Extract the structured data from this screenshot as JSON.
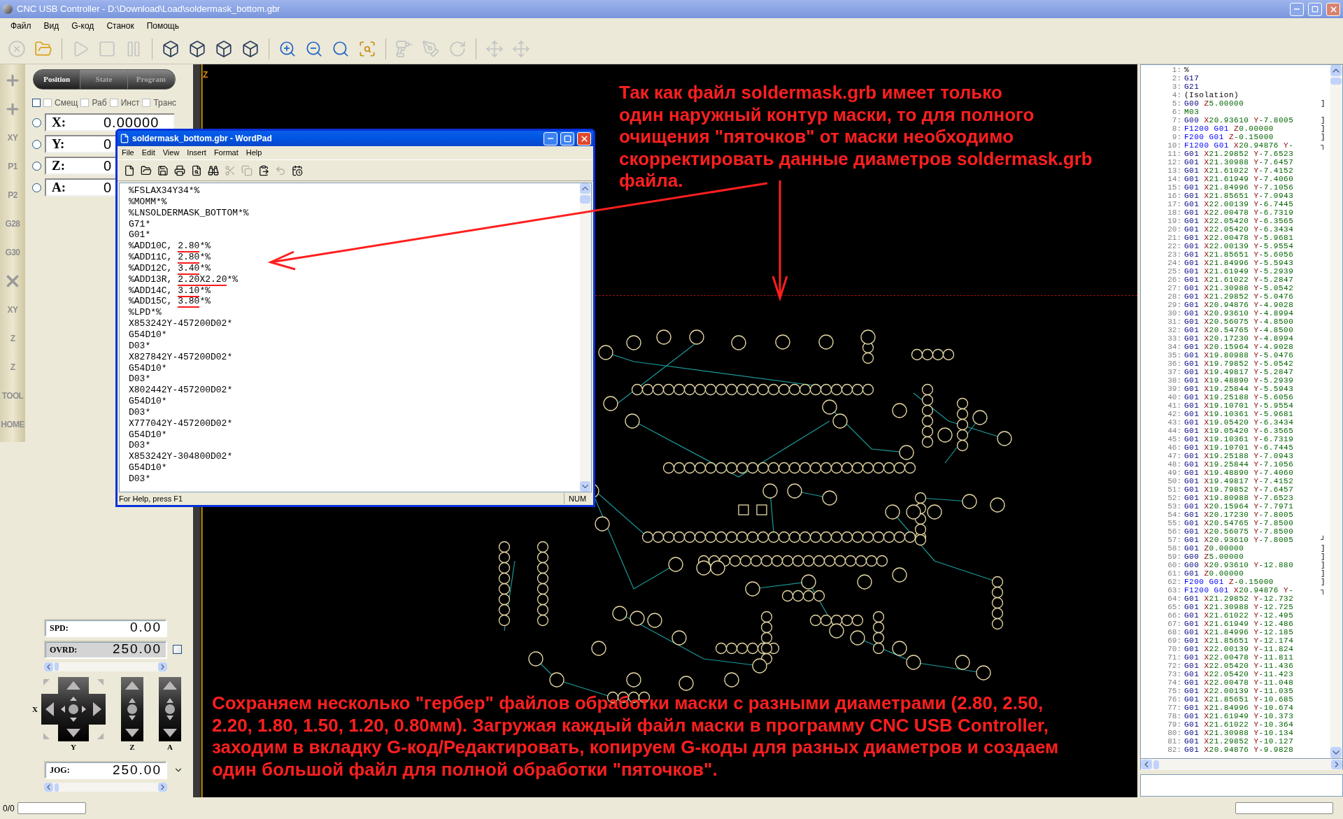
{
  "window": {
    "title": "CNC USB Controller - D:\\Download\\Load\\soldermask_bottom.gbr"
  },
  "menu": [
    "Файл",
    "Вид",
    "G-код",
    "Станок",
    "Помощь"
  ],
  "toolbar": [
    {
      "disabled": true
    },
    {
      "disabled": false
    },
    {
      "disabled": true
    },
    {
      "disabled": true
    },
    {
      "disabled": true
    },
    {
      "disabled": false
    },
    {
      "disabled": false
    },
    {
      "disabled": false
    },
    {
      "disabled": false
    },
    {
      "disabled": false
    },
    {
      "disabled": false
    },
    {
      "disabled": false
    },
    {
      "disabled": false
    },
    {
      "disabled": true
    },
    {
      "disabled": true
    },
    {
      "disabled": true
    },
    {
      "disabled": true
    },
    {
      "disabled": true
    }
  ],
  "jog_strip": [
    {
      "kind": "plus"
    },
    {
      "kind": "plus"
    },
    {
      "kind": "label",
      "label": "XY"
    },
    {
      "kind": "label",
      "label": "P1"
    },
    {
      "kind": "label",
      "label": "P2"
    },
    {
      "kind": "label",
      "label": "G28"
    },
    {
      "kind": "label",
      "label": "G30"
    },
    {
      "kind": "cross"
    },
    {
      "kind": "label",
      "label": "XY"
    },
    {
      "kind": "label",
      "label": "Z"
    },
    {
      "kind": "label",
      "label": "Z"
    },
    {
      "kind": "label",
      "label": "TOOL"
    },
    {
      "kind": "label",
      "label": "HOME"
    }
  ],
  "tabs": [
    {
      "label": "Position",
      "selected": true
    },
    {
      "label": "State",
      "selected": false
    },
    {
      "label": "Program",
      "selected": false
    }
  ],
  "checkboxes": [
    {
      "checked": false
    },
    {
      "label": "Смещ",
      "checked": false
    },
    {
      "label": "Раб",
      "checked": false
    },
    {
      "label": "Инст",
      "checked": false
    },
    {
      "label": "Транс",
      "checked": false
    }
  ],
  "axes": [
    {
      "label": "X:",
      "value": "0.00000",
      "selected": false
    },
    {
      "label": "Y:",
      "value": "0",
      "selected": false
    },
    {
      "label": "Z:",
      "value": "0",
      "selected": false
    },
    {
      "label": "A:",
      "value": "0",
      "selected": false
    }
  ],
  "spd": {
    "label": "SPD:",
    "value": "0.00"
  },
  "ovrd": {
    "label": "OVRD:",
    "value": "250.00",
    "checked": false
  },
  "jog_labels": {
    "x": "X",
    "y": "Y",
    "z": "Z",
    "a": "A"
  },
  "jog": {
    "label": "JOG:",
    "value": "250.00"
  },
  "canvas": {
    "axis_label": "Z"
  },
  "annotations": [
    [
      "Так как файл soldermask.grb имеет только",
      "один наружный контур маски, то для полного",
      "очищения \"пяточков\" от маски необходимо",
      "скорректировать данные диаметров soldermask.grb",
      "файла."
    ],
    [
      "Сохраняем несколько \"гербер\" файлов обработки маски с разными диаметрами (2.80, 2.50,",
      "2.20, 1.80, 1.50, 1.20, 0.80мм). Загружая каждый файл маски в программу CNC USB Controller,",
      "заходим в вкладку G-код/Редактировать, копируем G-коды для разных диаметров и создаем",
      "один большой файл для полной обработки \"пяточков\"."
    ]
  ],
  "wordpad": {
    "title": "soldermask_bottom.gbr - WordPad",
    "menu": [
      "File",
      "Edit",
      "View",
      "Insert",
      "Format",
      "Help"
    ],
    "toolbar": [
      {
        "disabled": false
      },
      {
        "disabled": false
      },
      {
        "disabled": false
      },
      {
        "disabled": false
      },
      {
        "disabled": false
      },
      {
        "disabled": false
      },
      {
        "disabled": true
      },
      {
        "disabled": true
      },
      {
        "disabled": false
      },
      {
        "disabled": true
      },
      {
        "disabled": false
      }
    ],
    "lines": [
      {
        "text": "%FSLAX34Y34*%"
      },
      {
        "text": "%MOMM*%"
      },
      {
        "text": "%LNSOLDERMASK_BOTTOM*%"
      },
      {
        "text": "G71*"
      },
      {
        "text": "G01*"
      },
      {
        "text": "%ADD10C, ",
        "underlined": "2.80",
        "after": "*%"
      },
      {
        "text": "%ADD11C, ",
        "underlined": "2.80",
        "after": "*%"
      },
      {
        "text": "%ADD12C, ",
        "underlined": "3.40",
        "after": "*%"
      },
      {
        "text": "%ADD13R, ",
        "underlined": "2.20X2.20",
        "after": "*%"
      },
      {
        "text": "%ADD14C, ",
        "underlined": "3.10",
        "after": "*%"
      },
      {
        "text": "%ADD15C, ",
        "underlined": "3.80",
        "after": "*%"
      },
      {
        "text": "%LPD*%"
      },
      {
        "text": "X853242Y-457200D02*"
      },
      {
        "text": "G54D10*"
      },
      {
        "text": "D03*"
      },
      {
        "text": "X827842Y-457200D02*"
      },
      {
        "text": "G54D10*"
      },
      {
        "text": "D03*"
      },
      {
        "text": "X802442Y-457200D02*"
      },
      {
        "text": "G54D10*"
      },
      {
        "text": "D03*"
      },
      {
        "text": "X777042Y-457200D02*"
      },
      {
        "text": "G54D10*"
      },
      {
        "text": "D03*"
      },
      {
        "text": "X853242Y-304800D02*"
      },
      {
        "text": "G54D10*"
      },
      {
        "text": "D03*"
      }
    ],
    "status": "For Help, press F1",
    "num": "NUM"
  },
  "code": [
    {
      "num": "1:",
      "tokens": [
        {
          "kind": "plain",
          "text": "%"
        }
      ]
    },
    {
      "num": "2:",
      "tokens": [
        {
          "kind": "cmd",
          "text": "G17"
        }
      ]
    },
    {
      "num": "3:",
      "tokens": [
        {
          "kind": "cmd",
          "text": "G21"
        }
      ]
    },
    {
      "num": "4:",
      "tokens": [
        {
          "kind": "plain",
          "text": "(Isolation)"
        }
      ]
    },
    {
      "num": "5:",
      "tokens": [
        {
          "kind": "cmd",
          "text": "G00"
        },
        {
          "kind": "axis",
          "text": "Z"
        },
        {
          "kind": "value",
          "text": "5.00000"
        }
      ],
      "marker": "]"
    },
    {
      "num": "6:",
      "tokens": [
        {
          "kind": "value",
          "text": "M03"
        }
      ]
    },
    {
      "num": "7:",
      "tokens": [
        {
          "kind": "cmd",
          "text": "G00"
        },
        {
          "kind": "axis",
          "text": "X"
        },
        {
          "kind": "value",
          "text": "20.93610"
        },
        {
          "kind": "axis",
          "text": "Y"
        },
        {
          "kind": "value",
          "text": "-7.8005"
        }
      ],
      "marker": "]"
    },
    {
      "num": "8:",
      "tokens": [
        {
          "kind": "feed",
          "text": "F1200 G01"
        },
        {
          "kind": "axis",
          "text": "Z"
        },
        {
          "kind": "value",
          "text": "0.00000"
        }
      ],
      "marker": "]"
    },
    {
      "num": "9:",
      "tokens": [
        {
          "kind": "feed",
          "text": "F200 G01"
        },
        {
          "kind": "axis",
          "text": "Z"
        },
        {
          "kind": "value",
          "text": "-0.15000"
        }
      ],
      "marker": "]"
    },
    {
      "num": "10:",
      "tokens": [
        {
          "kind": "feed",
          "text": "F1200 G01"
        },
        {
          "kind": "axis",
          "text": "X"
        },
        {
          "kind": "value",
          "text": "20.94876"
        },
        {
          "kind": "axis",
          "text": "Y"
        },
        {
          "kind": "value",
          "text": "-"
        }
      ],
      "marker": "┐"
    },
    {
      "num": "11:",
      "tokens": [
        {
          "kind": "cmd",
          "text": "G01"
        },
        {
          "kind": "axis",
          "text": "X"
        },
        {
          "kind": "value",
          "text": "21.29852"
        },
        {
          "kind": "axis",
          "text": "Y"
        },
        {
          "kind": "value",
          "text": "-7.6523"
        }
      ]
    },
    {
      "num": "12:",
      "tokens": [
        {
          "kind": "cmd",
          "text": "G01"
        },
        {
          "kind": "axis",
          "text": "X"
        },
        {
          "kind": "value",
          "text": "21.30988"
        },
        {
          "kind": "axis",
          "text": "Y"
        },
        {
          "kind": "value",
          "text": "-7.6457"
        }
      ]
    },
    {
      "num": "13:",
      "tokens": [
        {
          "kind": "cmd",
          "text": "G01"
        },
        {
          "kind": "axis",
          "text": "X"
        },
        {
          "kind": "value",
          "text": "21.61022"
        },
        {
          "kind": "axis",
          "text": "Y"
        },
        {
          "kind": "value",
          "text": "-7.4152"
        }
      ]
    },
    {
      "num": "14:",
      "tokens": [
        {
          "kind": "cmd",
          "text": "G01"
        },
        {
          "kind": "axis",
          "text": "X"
        },
        {
          "kind": "value",
          "text": "21.61949"
        },
        {
          "kind": "axis",
          "text": "Y"
        },
        {
          "kind": "value",
          "text": "-7.4060"
        }
      ]
    },
    {
      "num": "15:",
      "tokens": [
        {
          "kind": "cmd",
          "text": "G01"
        },
        {
          "kind": "axis",
          "text": "X"
        },
        {
          "kind": "value",
          "text": "21.84996"
        },
        {
          "kind": "axis",
          "text": "Y"
        },
        {
          "kind": "value",
          "text": "-7.1056"
        }
      ]
    },
    {
      "num": "16:",
      "tokens": [
        {
          "kind": "cmd",
          "text": "G01"
        },
        {
          "kind": "axis",
          "text": "X"
        },
        {
          "kind": "value",
          "text": "21.85651"
        },
        {
          "kind": "axis",
          "text": "Y"
        },
        {
          "kind": "value",
          "text": "-7.0943"
        }
      ]
    },
    {
      "num": "17:",
      "tokens": [
        {
          "kind": "cmd",
          "text": "G01"
        },
        {
          "kind": "axis",
          "text": "X"
        },
        {
          "kind": "value",
          "text": "22.00139"
        },
        {
          "kind": "axis",
          "text": "Y"
        },
        {
          "kind": "value",
          "text": "-6.7445"
        }
      ]
    },
    {
      "num": "18:",
      "tokens": [
        {
          "kind": "cmd",
          "text": "G01"
        },
        {
          "kind": "axis",
          "text": "X"
        },
        {
          "kind": "value",
          "text": "22.00478"
        },
        {
          "kind": "axis",
          "text": "Y"
        },
        {
          "kind": "value",
          "text": "-6.7319"
        }
      ]
    },
    {
      "num": "19:",
      "tokens": [
        {
          "kind": "cmd",
          "text": "G01"
        },
        {
          "kind": "axis",
          "text": "X"
        },
        {
          "kind": "value",
          "text": "22.05420"
        },
        {
          "kind": "axis",
          "text": "Y"
        },
        {
          "kind": "value",
          "text": "-6.3565"
        }
      ]
    },
    {
      "num": "20:",
      "tokens": [
        {
          "kind": "cmd",
          "text": "G01"
        },
        {
          "kind": "axis",
          "text": "X"
        },
        {
          "kind": "value",
          "text": "22.05420"
        },
        {
          "kind": "axis",
          "text": "Y"
        },
        {
          "kind": "value",
          "text": "-6.3434"
        }
      ]
    },
    {
      "num": "21:",
      "tokens": [
        {
          "kind": "cmd",
          "text": "G01"
        },
        {
          "kind": "axis",
          "text": "X"
        },
        {
          "kind": "value",
          "text": "22.00478"
        },
        {
          "kind": "axis",
          "text": "Y"
        },
        {
          "kind": "value",
          "text": "-5.9681"
        }
      ]
    },
    {
      "num": "22:",
      "tokens": [
        {
          "kind": "cmd",
          "text": "G01"
        },
        {
          "kind": "axis",
          "text": "X"
        },
        {
          "kind": "value",
          "text": "22.00139"
        },
        {
          "kind": "axis",
          "text": "Y"
        },
        {
          "kind": "value",
          "text": "-5.9554"
        }
      ]
    },
    {
      "num": "23:",
      "tokens": [
        {
          "kind": "cmd",
          "text": "G01"
        },
        {
          "kind": "axis",
          "text": "X"
        },
        {
          "kind": "value",
          "text": "21.85651"
        },
        {
          "kind": "axis",
          "text": "Y"
        },
        {
          "kind": "value",
          "text": "-5.6056"
        }
      ]
    },
    {
      "num": "24:",
      "tokens": [
        {
          "kind": "cmd",
          "text": "G01"
        },
        {
          "kind": "axis",
          "text": "X"
        },
        {
          "kind": "value",
          "text": "21.84996"
        },
        {
          "kind": "axis",
          "text": "Y"
        },
        {
          "kind": "value",
          "text": "-5.5943"
        }
      ]
    },
    {
      "num": "25:",
      "tokens": [
        {
          "kind": "cmd",
          "text": "G01"
        },
        {
          "kind": "axis",
          "text": "X"
        },
        {
          "kind": "value",
          "text": "21.61949"
        },
        {
          "kind": "axis",
          "text": "Y"
        },
        {
          "kind": "value",
          "text": "-5.2939"
        }
      ]
    },
    {
      "num": "26:",
      "tokens": [
        {
          "kind": "cmd",
          "text": "G01"
        },
        {
          "kind": "axis",
          "text": "X"
        },
        {
          "kind": "value",
          "text": "21.61022"
        },
        {
          "kind": "axis",
          "text": "Y"
        },
        {
          "kind": "value",
          "text": "-5.2847"
        }
      ]
    },
    {
      "num": "27:",
      "tokens": [
        {
          "kind": "cmd",
          "text": "G01"
        },
        {
          "kind": "axis",
          "text": "X"
        },
        {
          "kind": "value",
          "text": "21.30988"
        },
        {
          "kind": "axis",
          "text": "Y"
        },
        {
          "kind": "value",
          "text": "-5.0542"
        }
      ]
    },
    {
      "num": "28:",
      "tokens": [
        {
          "kind": "cmd",
          "text": "G01"
        },
        {
          "kind": "axis",
          "text": "X"
        },
        {
          "kind": "value",
          "text": "21.29852"
        },
        {
          "kind": "axis",
          "text": "Y"
        },
        {
          "kind": "value",
          "text": "-5.0476"
        }
      ]
    },
    {
      "num": "29:",
      "tokens": [
        {
          "kind": "cmd",
          "text": "G01"
        },
        {
          "kind": "axis",
          "text": "X"
        },
        {
          "kind": "value",
          "text": "20.94876"
        },
        {
          "kind": "axis",
          "text": "Y"
        },
        {
          "kind": "value",
          "text": "-4.9028"
        }
      ]
    },
    {
      "num": "30:",
      "tokens": [
        {
          "kind": "cmd",
          "text": "G01"
        },
        {
          "kind": "axis",
          "text": "X"
        },
        {
          "kind": "value",
          "text": "20.93610"
        },
        {
          "kind": "axis",
          "text": "Y"
        },
        {
          "kind": "value",
          "text": "-4.8994"
        }
      ]
    },
    {
      "num": "31:",
      "tokens": [
        {
          "kind": "cmd",
          "text": "G01"
        },
        {
          "kind": "axis",
          "text": "X"
        },
        {
          "kind": "value",
          "text": "20.56075"
        },
        {
          "kind": "axis",
          "text": "Y"
        },
        {
          "kind": "value",
          "text": "-4.8500"
        }
      ]
    },
    {
      "num": "32:",
      "tokens": [
        {
          "kind": "cmd",
          "text": "G01"
        },
        {
          "kind": "axis",
          "text": "X"
        },
        {
          "kind": "value",
          "text": "20.54765"
        },
        {
          "kind": "axis",
          "text": "Y"
        },
        {
          "kind": "value",
          "text": "-4.8500"
        }
      ]
    },
    {
      "num": "33:",
      "tokens": [
        {
          "kind": "cmd",
          "text": "G01"
        },
        {
          "kind": "axis",
          "text": "X"
        },
        {
          "kind": "value",
          "text": "20.17230"
        },
        {
          "kind": "axis",
          "text": "Y"
        },
        {
          "kind": "value",
          "text": "-4.8994"
        }
      ]
    },
    {
      "num": "34:",
      "tokens": [
        {
          "kind": "cmd",
          "text": "G01"
        },
        {
          "kind": "axis",
          "text": "X"
        },
        {
          "kind": "value",
          "text": "20.15964"
        },
        {
          "kind": "axis",
          "text": "Y"
        },
        {
          "kind": "value",
          "text": "-4.9028"
        }
      ]
    },
    {
      "num": "35:",
      "tokens": [
        {
          "kind": "cmd",
          "text": "G01"
        },
        {
          "kind": "axis",
          "text": "X"
        },
        {
          "kind": "value",
          "text": "19.80988"
        },
        {
          "kind": "axis",
          "text": "Y"
        },
        {
          "kind": "value",
          "text": "-5.0476"
        }
      ]
    },
    {
      "num": "36:",
      "tokens": [
        {
          "kind": "cmd",
          "text": "G01"
        },
        {
          "kind": "axis",
          "text": "X"
        },
        {
          "kind": "value",
          "text": "19.79852"
        },
        {
          "kind": "axis",
          "text": "Y"
        },
        {
          "kind": "value",
          "text": "-5.0542"
        }
      ]
    },
    {
      "num": "37:",
      "tokens": [
        {
          "kind": "cmd",
          "text": "G01"
        },
        {
          "kind": "axis",
          "text": "X"
        },
        {
          "kind": "value",
          "text": "19.49817"
        },
        {
          "kind": "axis",
          "text": "Y"
        },
        {
          "kind": "value",
          "text": "-5.2847"
        }
      ]
    },
    {
      "num": "38:",
      "tokens": [
        {
          "kind": "cmd",
          "text": "G01"
        },
        {
          "kind": "axis",
          "text": "X"
        },
        {
          "kind": "value",
          "text": "19.48890"
        },
        {
          "kind": "axis",
          "text": "Y"
        },
        {
          "kind": "value",
          "text": "-5.2939"
        }
      ]
    },
    {
      "num": "39:",
      "tokens": [
        {
          "kind": "cmd",
          "text": "G01"
        },
        {
          "kind": "axis",
          "text": "X"
        },
        {
          "kind": "value",
          "text": "19.25844"
        },
        {
          "kind": "axis",
          "text": "Y"
        },
        {
          "kind": "value",
          "text": "-5.5943"
        }
      ]
    },
    {
      "num": "40:",
      "tokens": [
        {
          "kind": "cmd",
          "text": "G01"
        },
        {
          "kind": "axis",
          "text": "X"
        },
        {
          "kind": "value",
          "text": "19.25188"
        },
        {
          "kind": "axis",
          "text": "Y"
        },
        {
          "kind": "value",
          "text": "-5.6056"
        }
      ]
    },
    {
      "num": "41:",
      "tokens": [
        {
          "kind": "cmd",
          "text": "G01"
        },
        {
          "kind": "axis",
          "text": "X"
        },
        {
          "kind": "value",
          "text": "19.10701"
        },
        {
          "kind": "axis",
          "text": "Y"
        },
        {
          "kind": "value",
          "text": "-5.9554"
        }
      ]
    },
    {
      "num": "42:",
      "tokens": [
        {
          "kind": "cmd",
          "text": "G01"
        },
        {
          "kind": "axis",
          "text": "X"
        },
        {
          "kind": "value",
          "text": "19.10361"
        },
        {
          "kind": "axis",
          "text": "Y"
        },
        {
          "kind": "value",
          "text": "-5.9681"
        }
      ]
    },
    {
      "num": "43:",
      "tokens": [
        {
          "kind": "cmd",
          "text": "G01"
        },
        {
          "kind": "axis",
          "text": "X"
        },
        {
          "kind": "value",
          "text": "19.05420"
        },
        {
          "kind": "axis",
          "text": "Y"
        },
        {
          "kind": "value",
          "text": "-6.3434"
        }
      ]
    },
    {
      "num": "44:",
      "tokens": [
        {
          "kind": "cmd",
          "text": "G01"
        },
        {
          "kind": "axis",
          "text": "X"
        },
        {
          "kind": "value",
          "text": "19.05420"
        },
        {
          "kind": "axis",
          "text": "Y"
        },
        {
          "kind": "value",
          "text": "-6.3565"
        }
      ]
    },
    {
      "num": "45:",
      "tokens": [
        {
          "kind": "cmd",
          "text": "G01"
        },
        {
          "kind": "axis",
          "text": "X"
        },
        {
          "kind": "value",
          "text": "19.10361"
        },
        {
          "kind": "axis",
          "text": "Y"
        },
        {
          "kind": "value",
          "text": "-6.7319"
        }
      ]
    },
    {
      "num": "46:",
      "tokens": [
        {
          "kind": "cmd",
          "text": "G01"
        },
        {
          "kind": "axis",
          "text": "X"
        },
        {
          "kind": "value",
          "text": "19.10701"
        },
        {
          "kind": "axis",
          "text": "Y"
        },
        {
          "kind": "value",
          "text": "-6.7445"
        }
      ]
    },
    {
      "num": "47:",
      "tokens": [
        {
          "kind": "cmd",
          "text": "G01"
        },
        {
          "kind": "axis",
          "text": "X"
        },
        {
          "kind": "value",
          "text": "19.25188"
        },
        {
          "kind": "axis",
          "text": "Y"
        },
        {
          "kind": "value",
          "text": "-7.0943"
        }
      ]
    },
    {
      "num": "48:",
      "tokens": [
        {
          "kind": "cmd",
          "text": "G01"
        },
        {
          "kind": "axis",
          "text": "X"
        },
        {
          "kind": "value",
          "text": "19.25844"
        },
        {
          "kind": "axis",
          "text": "Y"
        },
        {
          "kind": "value",
          "text": "-7.1056"
        }
      ]
    },
    {
      "num": "49:",
      "tokens": [
        {
          "kind": "cmd",
          "text": "G01"
        },
        {
          "kind": "axis",
          "text": "X"
        },
        {
          "kind": "value",
          "text": "19.48890"
        },
        {
          "kind": "axis",
          "text": "Y"
        },
        {
          "kind": "value",
          "text": "-7.4060"
        }
      ]
    },
    {
      "num": "50:",
      "tokens": [
        {
          "kind": "cmd",
          "text": "G01"
        },
        {
          "kind": "axis",
          "text": "X"
        },
        {
          "kind": "value",
          "text": "19.49817"
        },
        {
          "kind": "axis",
          "text": "Y"
        },
        {
          "kind": "value",
          "text": "-7.4152"
        }
      ]
    },
    {
      "num": "51:",
      "tokens": [
        {
          "kind": "cmd",
          "text": "G01"
        },
        {
          "kind": "axis",
          "text": "X"
        },
        {
          "kind": "value",
          "text": "19.79852"
        },
        {
          "kind": "axis",
          "text": "Y"
        },
        {
          "kind": "value",
          "text": "-7.6457"
        }
      ]
    },
    {
      "num": "52:",
      "tokens": [
        {
          "kind": "cmd",
          "text": "G01"
        },
        {
          "kind": "axis",
          "text": "X"
        },
        {
          "kind": "value",
          "text": "19.80988"
        },
        {
          "kind": "axis",
          "text": "Y"
        },
        {
          "kind": "value",
          "text": "-7.6523"
        }
      ]
    },
    {
      "num": "53:",
      "tokens": [
        {
          "kind": "cmd",
          "text": "G01"
        },
        {
          "kind": "axis",
          "text": "X"
        },
        {
          "kind": "value",
          "text": "20.15964"
        },
        {
          "kind": "axis",
          "text": "Y"
        },
        {
          "kind": "value",
          "text": "-7.7971"
        }
      ]
    },
    {
      "num": "54:",
      "tokens": [
        {
          "kind": "cmd",
          "text": "G01"
        },
        {
          "kind": "axis",
          "text": "X"
        },
        {
          "kind": "value",
          "text": "20.17230"
        },
        {
          "kind": "axis",
          "text": "Y"
        },
        {
          "kind": "value",
          "text": "-7.8005"
        }
      ]
    },
    {
      "num": "55:",
      "tokens": [
        {
          "kind": "cmd",
          "text": "G01"
        },
        {
          "kind": "axis",
          "text": "X"
        },
        {
          "kind": "value",
          "text": "20.54765"
        },
        {
          "kind": "axis",
          "text": "Y"
        },
        {
          "kind": "value",
          "text": "-7.8500"
        }
      ]
    },
    {
      "num": "56:",
      "tokens": [
        {
          "kind": "cmd",
          "text": "G01"
        },
        {
          "kind": "axis",
          "text": "X"
        },
        {
          "kind": "value",
          "text": "20.56075"
        },
        {
          "kind": "axis",
          "text": "Y"
        },
        {
          "kind": "value",
          "text": "-7.8500"
        }
      ]
    },
    {
      "num": "57:",
      "tokens": [
        {
          "kind": "cmd",
          "text": "G01"
        },
        {
          "kind": "axis",
          "text": "X"
        },
        {
          "kind": "value",
          "text": "20.93610"
        },
        {
          "kind": "axis",
          "text": "Y"
        },
        {
          "kind": "value",
          "text": "-7.8005"
        }
      ],
      "marker": "┘"
    },
    {
      "num": "58:",
      "tokens": [
        {
          "kind": "cmd",
          "text": "G01"
        },
        {
          "kind": "axis",
          "text": "Z"
        },
        {
          "kind": "value",
          "text": "0.00000"
        }
      ],
      "marker": "]"
    },
    {
      "num": "59:",
      "tokens": [
        {
          "kind": "cmd",
          "text": "G00"
        },
        {
          "kind": "axis",
          "text": "Z"
        },
        {
          "kind": "value",
          "text": "5.00000"
        }
      ],
      "marker": "]"
    },
    {
      "num": "60:",
      "tokens": [
        {
          "kind": "cmd",
          "text": "G00"
        },
        {
          "kind": "axis",
          "text": "X"
        },
        {
          "kind": "value",
          "text": "20.93610"
        },
        {
          "kind": "axis",
          "text": "Y"
        },
        {
          "kind": "value",
          "text": "-12.880"
        }
      ],
      "marker": "]"
    },
    {
      "num": "61:",
      "tokens": [
        {
          "kind": "cmd",
          "text": "G01"
        },
        {
          "kind": "axis",
          "text": "Z"
        },
        {
          "kind": "value",
          "text": "0.00000"
        }
      ],
      "marker": "]"
    },
    {
      "num": "62:",
      "tokens": [
        {
          "kind": "feed",
          "text": "F200 G01"
        },
        {
          "kind": "axis",
          "text": "Z"
        },
        {
          "kind": "value",
          "text": "-0.15000"
        }
      ],
      "marker": "]"
    },
    {
      "num": "63:",
      "tokens": [
        {
          "kind": "feed",
          "text": "F1200 G01"
        },
        {
          "kind": "axis",
          "text": "X"
        },
        {
          "kind": "value",
          "text": "20.94876"
        },
        {
          "kind": "axis",
          "text": "Y"
        },
        {
          "kind": "value",
          "text": "-"
        }
      ],
      "marker": "┐"
    },
    {
      "num": "64:",
      "tokens": [
        {
          "kind": "cmd",
          "text": "G01"
        },
        {
          "kind": "axis",
          "text": "X"
        },
        {
          "kind": "value",
          "text": "21.29852"
        },
        {
          "kind": "axis",
          "text": "Y"
        },
        {
          "kind": "value",
          "text": "-12.732"
        }
      ]
    },
    {
      "num": "65:",
      "tokens": [
        {
          "kind": "cmd",
          "text": "G01"
        },
        {
          "kind": "axis",
          "text": "X"
        },
        {
          "kind": "value",
          "text": "21.30988"
        },
        {
          "kind": "axis",
          "text": "Y"
        },
        {
          "kind": "value",
          "text": "-12.725"
        }
      ]
    },
    {
      "num": "66:",
      "tokens": [
        {
          "kind": "cmd",
          "text": "G01"
        },
        {
          "kind": "axis",
          "text": "X"
        },
        {
          "kind": "value",
          "text": "21.61022"
        },
        {
          "kind": "axis",
          "text": "Y"
        },
        {
          "kind": "value",
          "text": "-12.495"
        }
      ]
    },
    {
      "num": "67:",
      "tokens": [
        {
          "kind": "cmd",
          "text": "G01"
        },
        {
          "kind": "axis",
          "text": "X"
        },
        {
          "kind": "value",
          "text": "21.61949"
        },
        {
          "kind": "axis",
          "text": "Y"
        },
        {
          "kind": "value",
          "text": "-12.486"
        }
      ]
    },
    {
      "num": "68:",
      "tokens": [
        {
          "kind": "cmd",
          "text": "G01"
        },
        {
          "kind": "axis",
          "text": "X"
        },
        {
          "kind": "value",
          "text": "21.84996"
        },
        {
          "kind": "axis",
          "text": "Y"
        },
        {
          "kind": "value",
          "text": "-12.185"
        }
      ]
    },
    {
      "num": "69:",
      "tokens": [
        {
          "kind": "cmd",
          "text": "G01"
        },
        {
          "kind": "axis",
          "text": "X"
        },
        {
          "kind": "value",
          "text": "21.85651"
        },
        {
          "kind": "axis",
          "text": "Y"
        },
        {
          "kind": "value",
          "text": "-12.174"
        }
      ]
    },
    {
      "num": "70:",
      "tokens": [
        {
          "kind": "cmd",
          "text": "G01"
        },
        {
          "kind": "axis",
          "text": "X"
        },
        {
          "kind": "value",
          "text": "22.00139"
        },
        {
          "kind": "axis",
          "text": "Y"
        },
        {
          "kind": "value",
          "text": "-11.824"
        }
      ]
    },
    {
      "num": "71:",
      "tokens": [
        {
          "kind": "cmd",
          "text": "G01"
        },
        {
          "kind": "axis",
          "text": "X"
        },
        {
          "kind": "value",
          "text": "22.00478"
        },
        {
          "kind": "axis",
          "text": "Y"
        },
        {
          "kind": "value",
          "text": "-11.811"
        }
      ]
    },
    {
      "num": "72:",
      "tokens": [
        {
          "kind": "cmd",
          "text": "G01"
        },
        {
          "kind": "axis",
          "text": "X"
        },
        {
          "kind": "value",
          "text": "22.05420"
        },
        {
          "kind": "axis",
          "text": "Y"
        },
        {
          "kind": "value",
          "text": "-11.436"
        }
      ]
    },
    {
      "num": "73:",
      "tokens": [
        {
          "kind": "cmd",
          "text": "G01"
        },
        {
          "kind": "axis",
          "text": "X"
        },
        {
          "kind": "value",
          "text": "22.05420"
        },
        {
          "kind": "axis",
          "text": "Y"
        },
        {
          "kind": "value",
          "text": "-11.423"
        }
      ]
    },
    {
      "num": "74:",
      "tokens": [
        {
          "kind": "cmd",
          "text": "G01"
        },
        {
          "kind": "axis",
          "text": "X"
        },
        {
          "kind": "value",
          "text": "22.00478"
        },
        {
          "kind": "axis",
          "text": "Y"
        },
        {
          "kind": "value",
          "text": "-11.048"
        }
      ]
    },
    {
      "num": "75:",
      "tokens": [
        {
          "kind": "cmd",
          "text": "G01"
        },
        {
          "kind": "axis",
          "text": "X"
        },
        {
          "kind": "value",
          "text": "22.00139"
        },
        {
          "kind": "axis",
          "text": "Y"
        },
        {
          "kind": "value",
          "text": "-11.035"
        }
      ]
    },
    {
      "num": "76:",
      "tokens": [
        {
          "kind": "cmd",
          "text": "G01"
        },
        {
          "kind": "axis",
          "text": "X"
        },
        {
          "kind": "value",
          "text": "21.85651"
        },
        {
          "kind": "axis",
          "text": "Y"
        },
        {
          "kind": "value",
          "text": "-10.685"
        }
      ]
    },
    {
      "num": "77:",
      "tokens": [
        {
          "kind": "cmd",
          "text": "G01"
        },
        {
          "kind": "axis",
          "text": "X"
        },
        {
          "kind": "value",
          "text": "21.84996"
        },
        {
          "kind": "axis",
          "text": "Y"
        },
        {
          "kind": "value",
          "text": "-10.674"
        }
      ]
    },
    {
      "num": "78:",
      "tokens": [
        {
          "kind": "cmd",
          "text": "G01"
        },
        {
          "kind": "axis",
          "text": "X"
        },
        {
          "kind": "value",
          "text": "21.61949"
        },
        {
          "kind": "axis",
          "text": "Y"
        },
        {
          "kind": "value",
          "text": "-10.373"
        }
      ]
    },
    {
      "num": "79:",
      "tokens": [
        {
          "kind": "cmd",
          "text": "G01"
        },
        {
          "kind": "axis",
          "text": "X"
        },
        {
          "kind": "value",
          "text": "21.61022"
        },
        {
          "kind": "axis",
          "text": "Y"
        },
        {
          "kind": "value",
          "text": "-10.364"
        }
      ]
    },
    {
      "num": "80:",
      "tokens": [
        {
          "kind": "cmd",
          "text": "G01"
        },
        {
          "kind": "axis",
          "text": "X"
        },
        {
          "kind": "value",
          "text": "21.30988"
        },
        {
          "kind": "axis",
          "text": "Y"
        },
        {
          "kind": "value",
          "text": "-10.134"
        }
      ]
    },
    {
      "num": "81:",
      "tokens": [
        {
          "kind": "cmd",
          "text": "G01"
        },
        {
          "kind": "axis",
          "text": "X"
        },
        {
          "kind": "value",
          "text": "21.29852"
        },
        {
          "kind": "axis",
          "text": "Y"
        },
        {
          "kind": "value",
          "text": "-10.127"
        }
      ]
    },
    {
      "num": "82:",
      "tokens": [
        {
          "kind": "cmd",
          "text": "G01"
        },
        {
          "kind": "axis",
          "text": "X"
        },
        {
          "kind": "value",
          "text": "20.94876"
        },
        {
          "kind": "axis",
          "text": "Y"
        },
        {
          "kind": "value",
          "text": "-9.9828"
        }
      ]
    }
  ],
  "status_bar": {
    "progress": "0/0"
  }
}
